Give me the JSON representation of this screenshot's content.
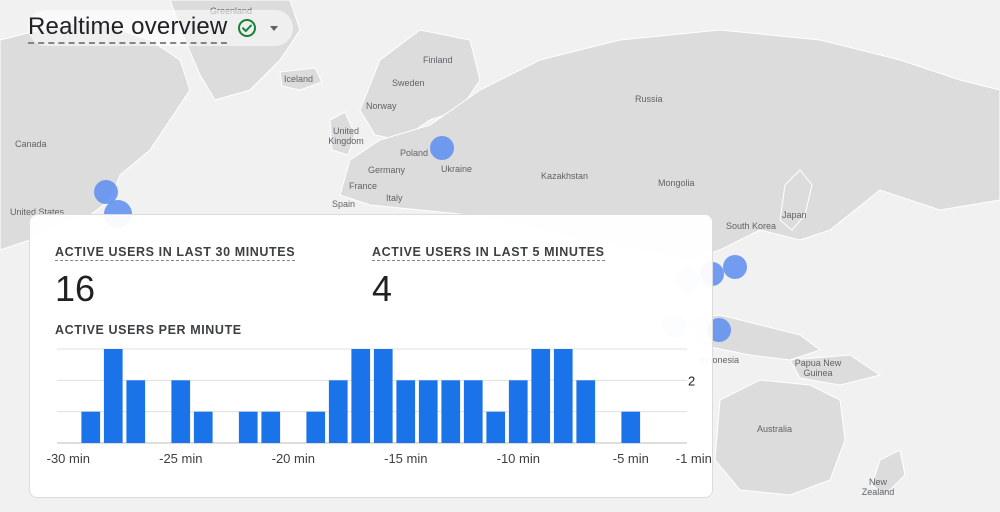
{
  "header": {
    "title": "Realtime overview",
    "status_icon": "check-circle-icon",
    "dropdown_icon": "chevron-down-icon"
  },
  "map": {
    "countries": [
      "Greenland",
      "Iceland",
      "Finland",
      "Sweden",
      "Norway",
      "Russia",
      "Canada",
      "United Kingdom",
      "Poland",
      "Germany",
      "Ukraine",
      "France",
      "Kazakhstan",
      "Mongolia",
      "Spain",
      "Italy",
      "Japan",
      "South Korea",
      "United States",
      "Papua New Guinea",
      "Indonesia",
      "Australia",
      "New Zealand"
    ],
    "dot_color": "#5b8def"
  },
  "card": {
    "metric_30": {
      "label": "ACTIVE USERS IN LAST 30 MINUTES",
      "value": "16"
    },
    "metric_5": {
      "label": "ACTIVE USERS IN LAST 5 MINUTES",
      "value": "4"
    },
    "chart_label": "ACTIVE USERS PER MINUTE"
  },
  "chart_data": {
    "type": "bar",
    "xlabel": "",
    "ylabel": "",
    "x_tick_labels": [
      "-30 min",
      "-25 min",
      "-20 min",
      "-15 min",
      "-10 min",
      "-5 min",
      "-1 min"
    ],
    "y_tick_labels": [
      "2"
    ],
    "ylim": [
      0,
      3
    ],
    "bar_color": "#1a73e8",
    "values": [
      0,
      1,
      3,
      2,
      0,
      2,
      1,
      0,
      1,
      1,
      0,
      1,
      2,
      3,
      3,
      2,
      2,
      2,
      2,
      1,
      2,
      3,
      3,
      2,
      0,
      1,
      0,
      0
    ],
    "y_axis_position": "right",
    "grid": true
  }
}
